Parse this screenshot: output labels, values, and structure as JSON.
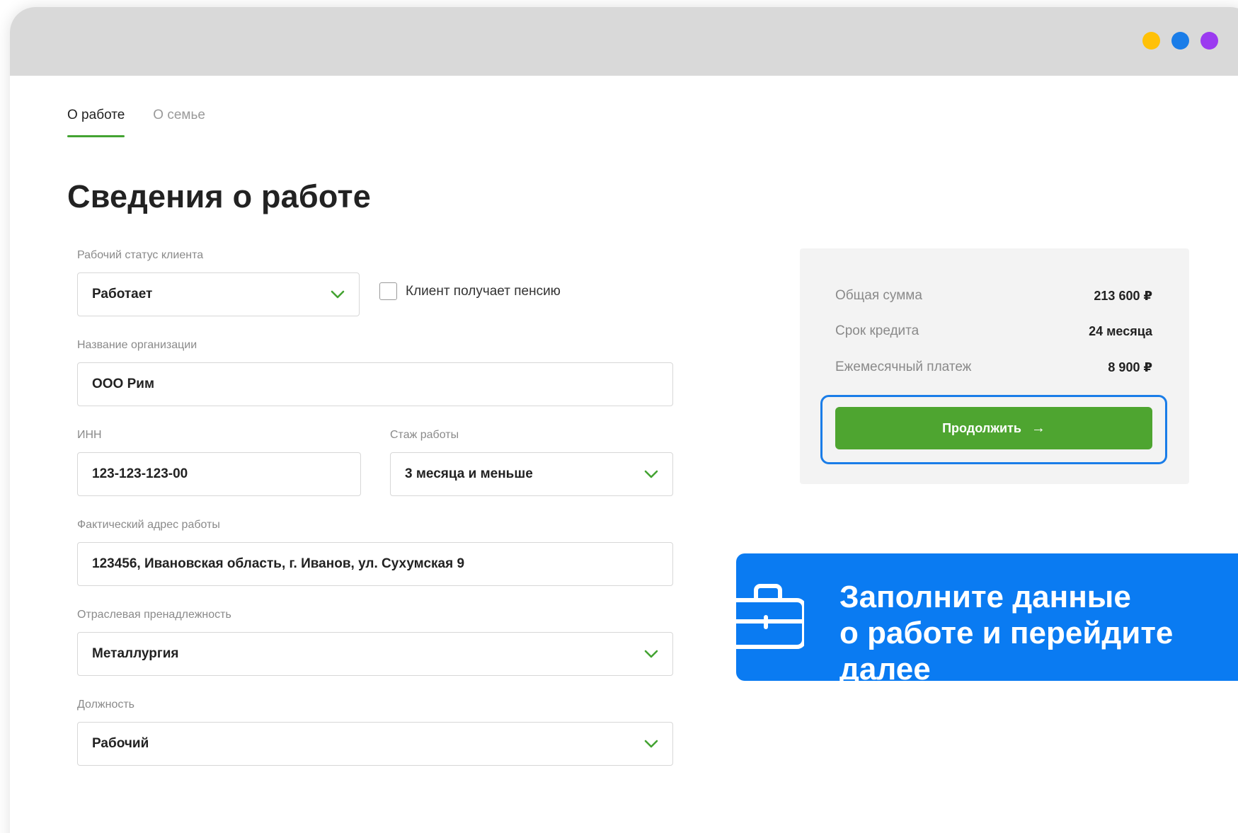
{
  "window": {
    "dots": [
      {
        "name": "yellow-dot",
        "color": "#ffc107"
      },
      {
        "name": "blue-dot",
        "color": "#1a7de8"
      },
      {
        "name": "purple-dot",
        "color": "#9b3bf0"
      }
    ]
  },
  "tabs": [
    {
      "label": "О работе",
      "active": true
    },
    {
      "label": "О семье",
      "active": false
    }
  ],
  "page_title": "Сведения о работе",
  "form": {
    "work_status": {
      "label": "Рабочий статус клиента",
      "value": "Работает"
    },
    "pension_checkbox": {
      "label": "Клиент получает пенсию",
      "checked": false
    },
    "organization": {
      "label": "Название организации",
      "value": "ООО Рим"
    },
    "inn": {
      "label": "ИНН",
      "value": "123-123-123-00"
    },
    "experience": {
      "label": "Стаж работы",
      "value": "3 месяца и меньше"
    },
    "work_address": {
      "label": "Фактический адрес работы",
      "value": "123456, Ивановская область, г. Иванов, ул. Сухумская 9"
    },
    "industry": {
      "label": "Отраслевая пренадлежность",
      "value": "Металлургия"
    },
    "position": {
      "label": "Должность",
      "value": "Рабочий"
    }
  },
  "summary": {
    "total": {
      "label": "Общая сумма",
      "value": "213 600 ₽"
    },
    "term": {
      "label": "Срок кредита",
      "value": "24 месяца"
    },
    "monthly": {
      "label": "Ежемесячный платеж",
      "value": "8 900 ₽"
    },
    "continue_label": "Продолжить",
    "continue_arrow": "→"
  },
  "banner": {
    "icon": "briefcase-icon",
    "line1": "Заполните данные",
    "line2": "о работе и перейдите",
    "line3": "далее"
  },
  "colors": {
    "accent_green": "#4ea530",
    "tab_underline": "#43a332",
    "chevron_green": "#43a332",
    "banner_blue": "#0a7bf2",
    "focus_blue": "#1a7de8"
  }
}
